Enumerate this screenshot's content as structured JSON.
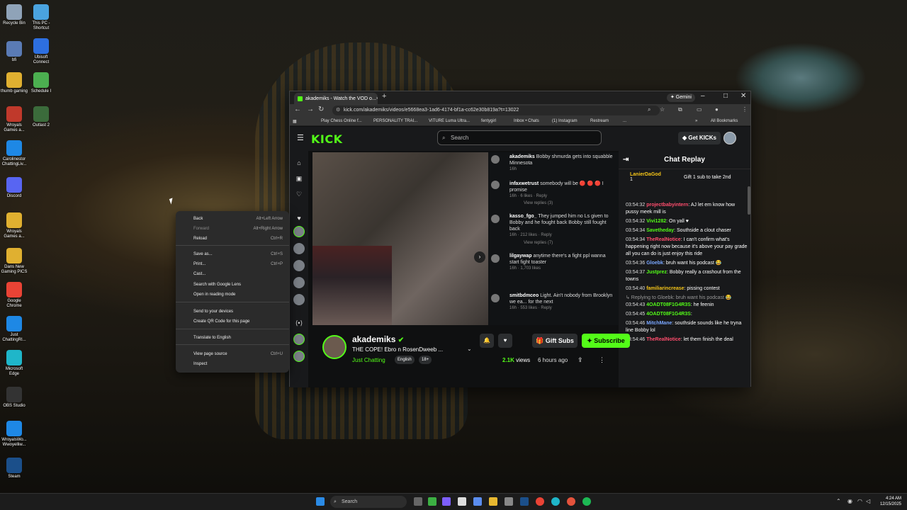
{
  "desktop": {
    "icons": [
      {
        "label": "Recycle Bin",
        "color": "#8fa3b8"
      },
      {
        "label": "This PC - Shortcut",
        "color": "#4aa3df"
      },
      {
        "label": "bfi",
        "color": "#5a7bb5"
      },
      {
        "label": "Ubisoft Connect",
        "color": "#2d6fe0"
      },
      {
        "label": "thumb gaming",
        "color": "#e0b030"
      },
      {
        "label": "Schedule I",
        "color": "#4caf50"
      },
      {
        "label": "Wroyals Games a...",
        "color": "#c0392b"
      },
      {
        "label": "Outlast 2",
        "color": "#3b6b3b"
      },
      {
        "label": "Carolinestor ChattingLiv...",
        "color": "#1e88e5"
      },
      {
        "label": "Discord",
        "color": "#5865f2"
      },
      {
        "label": "Wroyals Games a...",
        "color": "#e0b030"
      },
      {
        "label": "Dans New Gaming PICS",
        "color": "#e0b030"
      },
      {
        "label": "Google Chrome",
        "color": "#ea4335"
      },
      {
        "label": "Just ChattingRI...",
        "color": "#1e88e5"
      },
      {
        "label": "Microsoft Edge",
        "color": "#1fb6c9"
      },
      {
        "label": "OBS Studio",
        "color": "#333333"
      },
      {
        "label": "WroyalsWo... Wwoyelliw...",
        "color": "#1e88e5"
      },
      {
        "label": "Steam",
        "color": "#1b4f8a"
      }
    ]
  },
  "browser": {
    "tab_title": "akademiks - Watch the VOD o...",
    "tab_close": "×",
    "new_tab": "+",
    "gemini_label": "✦ Gemini",
    "url": "kick.com/akademiks/videos/e5668ea3-1ad6-4174-bf1a-cc62e30b819a?t=13022",
    "bookmarks": [
      "Play Chess Online f...",
      "PERSONALITY TRAI...",
      "VITURE Luma Ultra...",
      "fentygirl",
      "Inbox • Chats",
      "(1) Instagram",
      "Restream",
      "..."
    ],
    "all_bookmarks": "All Bookmarks",
    "bookmarks_more": "»"
  },
  "kick": {
    "logo": "KICK",
    "search_placeholder": "Search",
    "get_kicks": "Get KICKs",
    "chat_title": "Chat Replay",
    "pinned_user": "LanierDaGod",
    "pinned_count": "1",
    "pinned_text": "Gift 1 sub to take 2nd",
    "chat": [
      {
        "time": "03:54:32",
        "user": "projectbabyintern",
        "color": "#ff4d6d",
        "msg": ": AJ let em know how pussy meek mill is"
      },
      {
        "time": "03:54:32",
        "user": "Vivi1282",
        "color": "#53fc18",
        "msg": ": On yall ♥"
      },
      {
        "time": "03:54:34",
        "user": "Savetheday",
        "color": "#53fc18",
        "msg": ": Southside a clout chaser"
      },
      {
        "time": "03:54:34",
        "user": "TheRealNotice",
        "color": "#ff4d6d",
        "msg": ": I can't confirm what's happening right now because it's above your pay grade all you can do is just enjoy this ride"
      },
      {
        "time": "03:54:36",
        "user": "Gloebk",
        "color": "#7aa7ff",
        "msg": ": bruh want his podcast 😂"
      },
      {
        "time": "03:54:37",
        "user": "Justprez",
        "color": "#53fc18",
        "msg": ": Bobby really a crashout from the towns"
      },
      {
        "time": "03:54:40",
        "user": "familiarincrease",
        "color": "#f5c518",
        "msg": ": pissing contest"
      },
      {
        "time": "03:54:43",
        "user": "4OADT08F1G4R3S",
        "color": "#53fc18",
        "msg": ": he feenin",
        "reply": "↳ Replying to Gloebk: bruh want his podcast 😂"
      },
      {
        "time": "03:54:45",
        "user": "4OADT08F1G4R3S",
        "color": "#53fc18",
        "msg": ":"
      },
      {
        "time": "03:54:46",
        "user": "MitchMane",
        "color": "#7aa7ff",
        "msg": ": southside sounds like he tryna line Bobby lol"
      },
      {
        "time": "03:54:46",
        "user": "TheRealNotice",
        "color": "#ff4d6d",
        "msg": ": let them finish the deal"
      }
    ],
    "video_comments": [
      {
        "user": "akademiks",
        "text": "Bobby shmurda gets into squabble Minnesota",
        "time": "16h"
      },
      {
        "user": "infaxwetrust",
        "text": "somebody will be 🔴 🔴 🔴 I promise",
        "time": "16h · 6 likes · Reply"
      },
      {
        "user": "",
        "text": "View replies (3)",
        "time": ""
      },
      {
        "user": "kasso_fgo_",
        "text": "They jumped him no Ls given to Bobby and he fought back Bobby still fought back",
        "time": "16h · 212 likes · Reply"
      },
      {
        "user": "",
        "text": "View replies (7)",
        "time": ""
      },
      {
        "user": "lilgaywap",
        "text": "anytime there's a fight ppl wanna start fight toaster",
        "time": "16h · 1,703 likes"
      },
      {
        "user": "smitbdmceo",
        "text": "Light. Ain't nobody from Brooklyn we ea... for the next",
        "time": "16h · 553 likes · Reply"
      }
    ],
    "channel": "akademiks",
    "verified": "✔",
    "stream_title": "THE COPE! Ebro n RosenDweeb ...",
    "category": "Just Chatting",
    "tags": [
      "English",
      "18+"
    ],
    "gift_subs": "Gift Subs",
    "subscribe": "Subscribe",
    "views": "2.1K",
    "views_label": "views",
    "ago": "6 hours ago"
  },
  "context_menu": {
    "items": [
      {
        "label": "Back",
        "shortcut": "Alt+Left Arrow"
      },
      {
        "label": "Forward",
        "shortcut": "Alt+Right Arrow"
      },
      {
        "label": "Reload",
        "shortcut": "Ctrl+R"
      },
      {
        "label": "Save as...",
        "shortcut": "Ctrl+S"
      },
      {
        "label": "Print...",
        "shortcut": "Ctrl+P"
      },
      {
        "label": "Cast...",
        "shortcut": ""
      },
      {
        "label": "Search with Google Lens",
        "shortcut": ""
      },
      {
        "label": "Open in reading mode",
        "shortcut": ""
      },
      {
        "label": "Send to your devices",
        "shortcut": ""
      },
      {
        "label": "Create QR Code for this page",
        "shortcut": ""
      },
      {
        "label": "Translate to English",
        "shortcut": ""
      },
      {
        "label": "View page source",
        "shortcut": "Ctrl+U"
      },
      {
        "label": "Inspect",
        "shortcut": ""
      }
    ]
  },
  "taskbar": {
    "search": "Search",
    "time": "4:24 AM",
    "date": "12/15/2025"
  }
}
